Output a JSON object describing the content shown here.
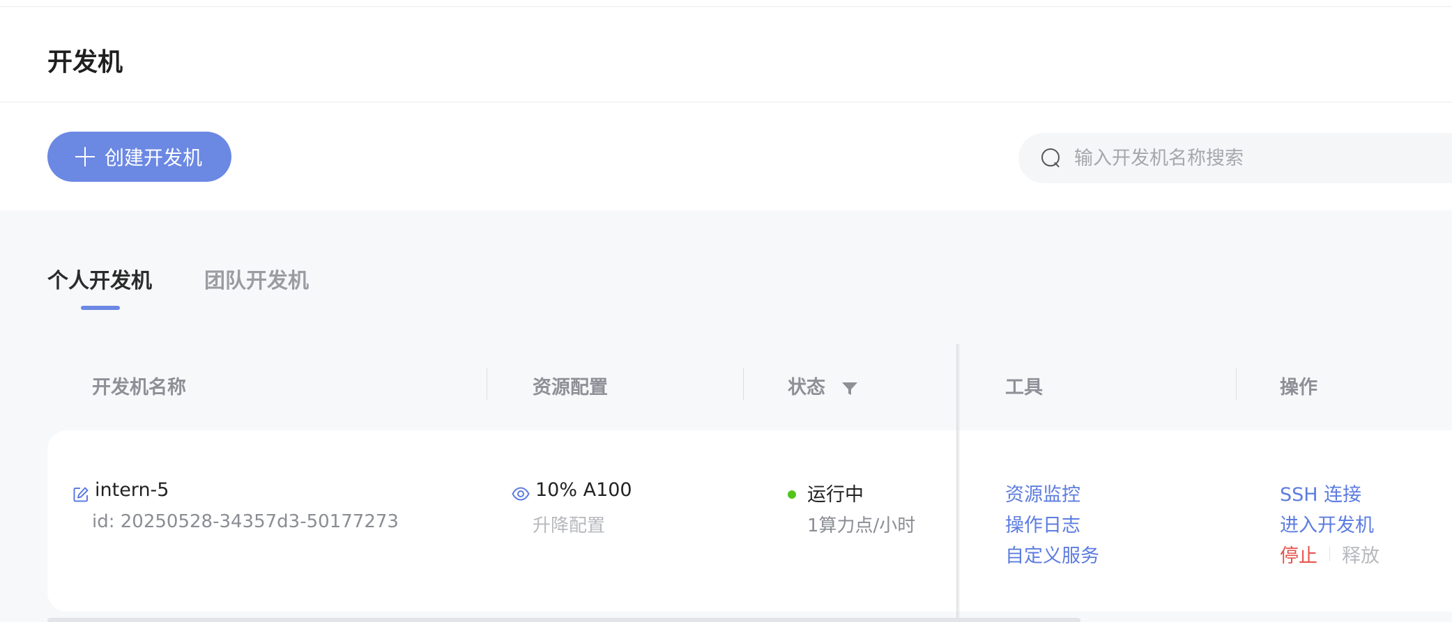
{
  "header": {
    "title": "开发机"
  },
  "toolbar": {
    "create_label": "创建开发机",
    "search_placeholder": "输入开发机名称搜索"
  },
  "tabs": [
    {
      "label": "个人开发机",
      "active": true
    },
    {
      "label": "团队开发机",
      "active": false
    }
  ],
  "table": {
    "columns": [
      "开发机名称",
      "资源配置",
      "状态",
      "工具",
      "操作"
    ],
    "rows": [
      {
        "name": "intern-5",
        "id": "id: 20250528-34357d3-50177273",
        "resource": "10% A100",
        "resource_action": "升降配置",
        "status": "运行中",
        "status_color": "#52c41a",
        "cost": "1算力点/小时",
        "tools": [
          "资源监控",
          "操作日志",
          "自定义服务"
        ],
        "actions": {
          "ssh": "SSH 连接",
          "enter": "进入开发机",
          "stop": "停止",
          "release": "释放"
        }
      }
    ]
  },
  "colors": {
    "accent": "#6b88e3",
    "link": "#5c7cdf",
    "danger": "#e5534b",
    "disabled": "#b7b9bd",
    "running": "#52c41a"
  }
}
